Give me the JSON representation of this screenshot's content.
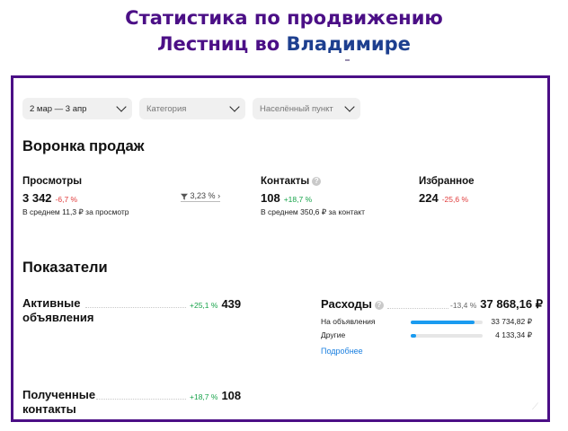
{
  "heading": {
    "line1": "Статистика по продвижению",
    "line2_part1": "Лестниц во ",
    "line2_part2": "Владимире"
  },
  "filters": {
    "period": "2 мар — 3 апр",
    "category_placeholder": "Категория",
    "locality_placeholder": "Населённый пункт"
  },
  "funnel": {
    "title": "Воронка продаж",
    "views": {
      "label": "Просмотры",
      "value": "3 342",
      "change": "-6,7 %",
      "sub": "В среднем 11,3 ₽ за просмотр"
    },
    "conversion": "3,23 %",
    "contacts": {
      "label": "Контакты",
      "value": "108",
      "change": "+18,7 %",
      "sub": "В среднем 350,6 ₽ за контакт"
    },
    "favorites": {
      "label": "Избранное",
      "value": "224",
      "change": "-25,6 %"
    }
  },
  "indicators": {
    "title": "Показатели",
    "active": {
      "label_line1": "Активные",
      "label_line2": "объявления",
      "change": "+25,1 %",
      "value": "439"
    },
    "received": {
      "label_line1": "Полученные",
      "label_line2": "контакты",
      "change": "+18,7 %",
      "value": "108"
    },
    "expenses": {
      "label": "Расходы",
      "change": "-13,4 %",
      "value": "37 868,16 ₽",
      "items": [
        {
          "label": "На объявления",
          "value": "33 734,82 ₽",
          "share": 0.89
        },
        {
          "label": "Другие",
          "value": "4 133,34 ₽",
          "share": 0.07
        }
      ],
      "more_label": "Подробнее"
    }
  },
  "colors": {
    "frame": "#4b0f86",
    "title_purple": "#4b0f86",
    "title_blue": "#1d3f8f",
    "positive": "#17a34a",
    "negative": "#e03b3b",
    "bar": "#1a9bf0",
    "link": "#1a7fe0"
  },
  "icons": {
    "chevron": "chevron-down-icon",
    "help": "help-circle-icon",
    "funnel": "funnel-icon"
  }
}
